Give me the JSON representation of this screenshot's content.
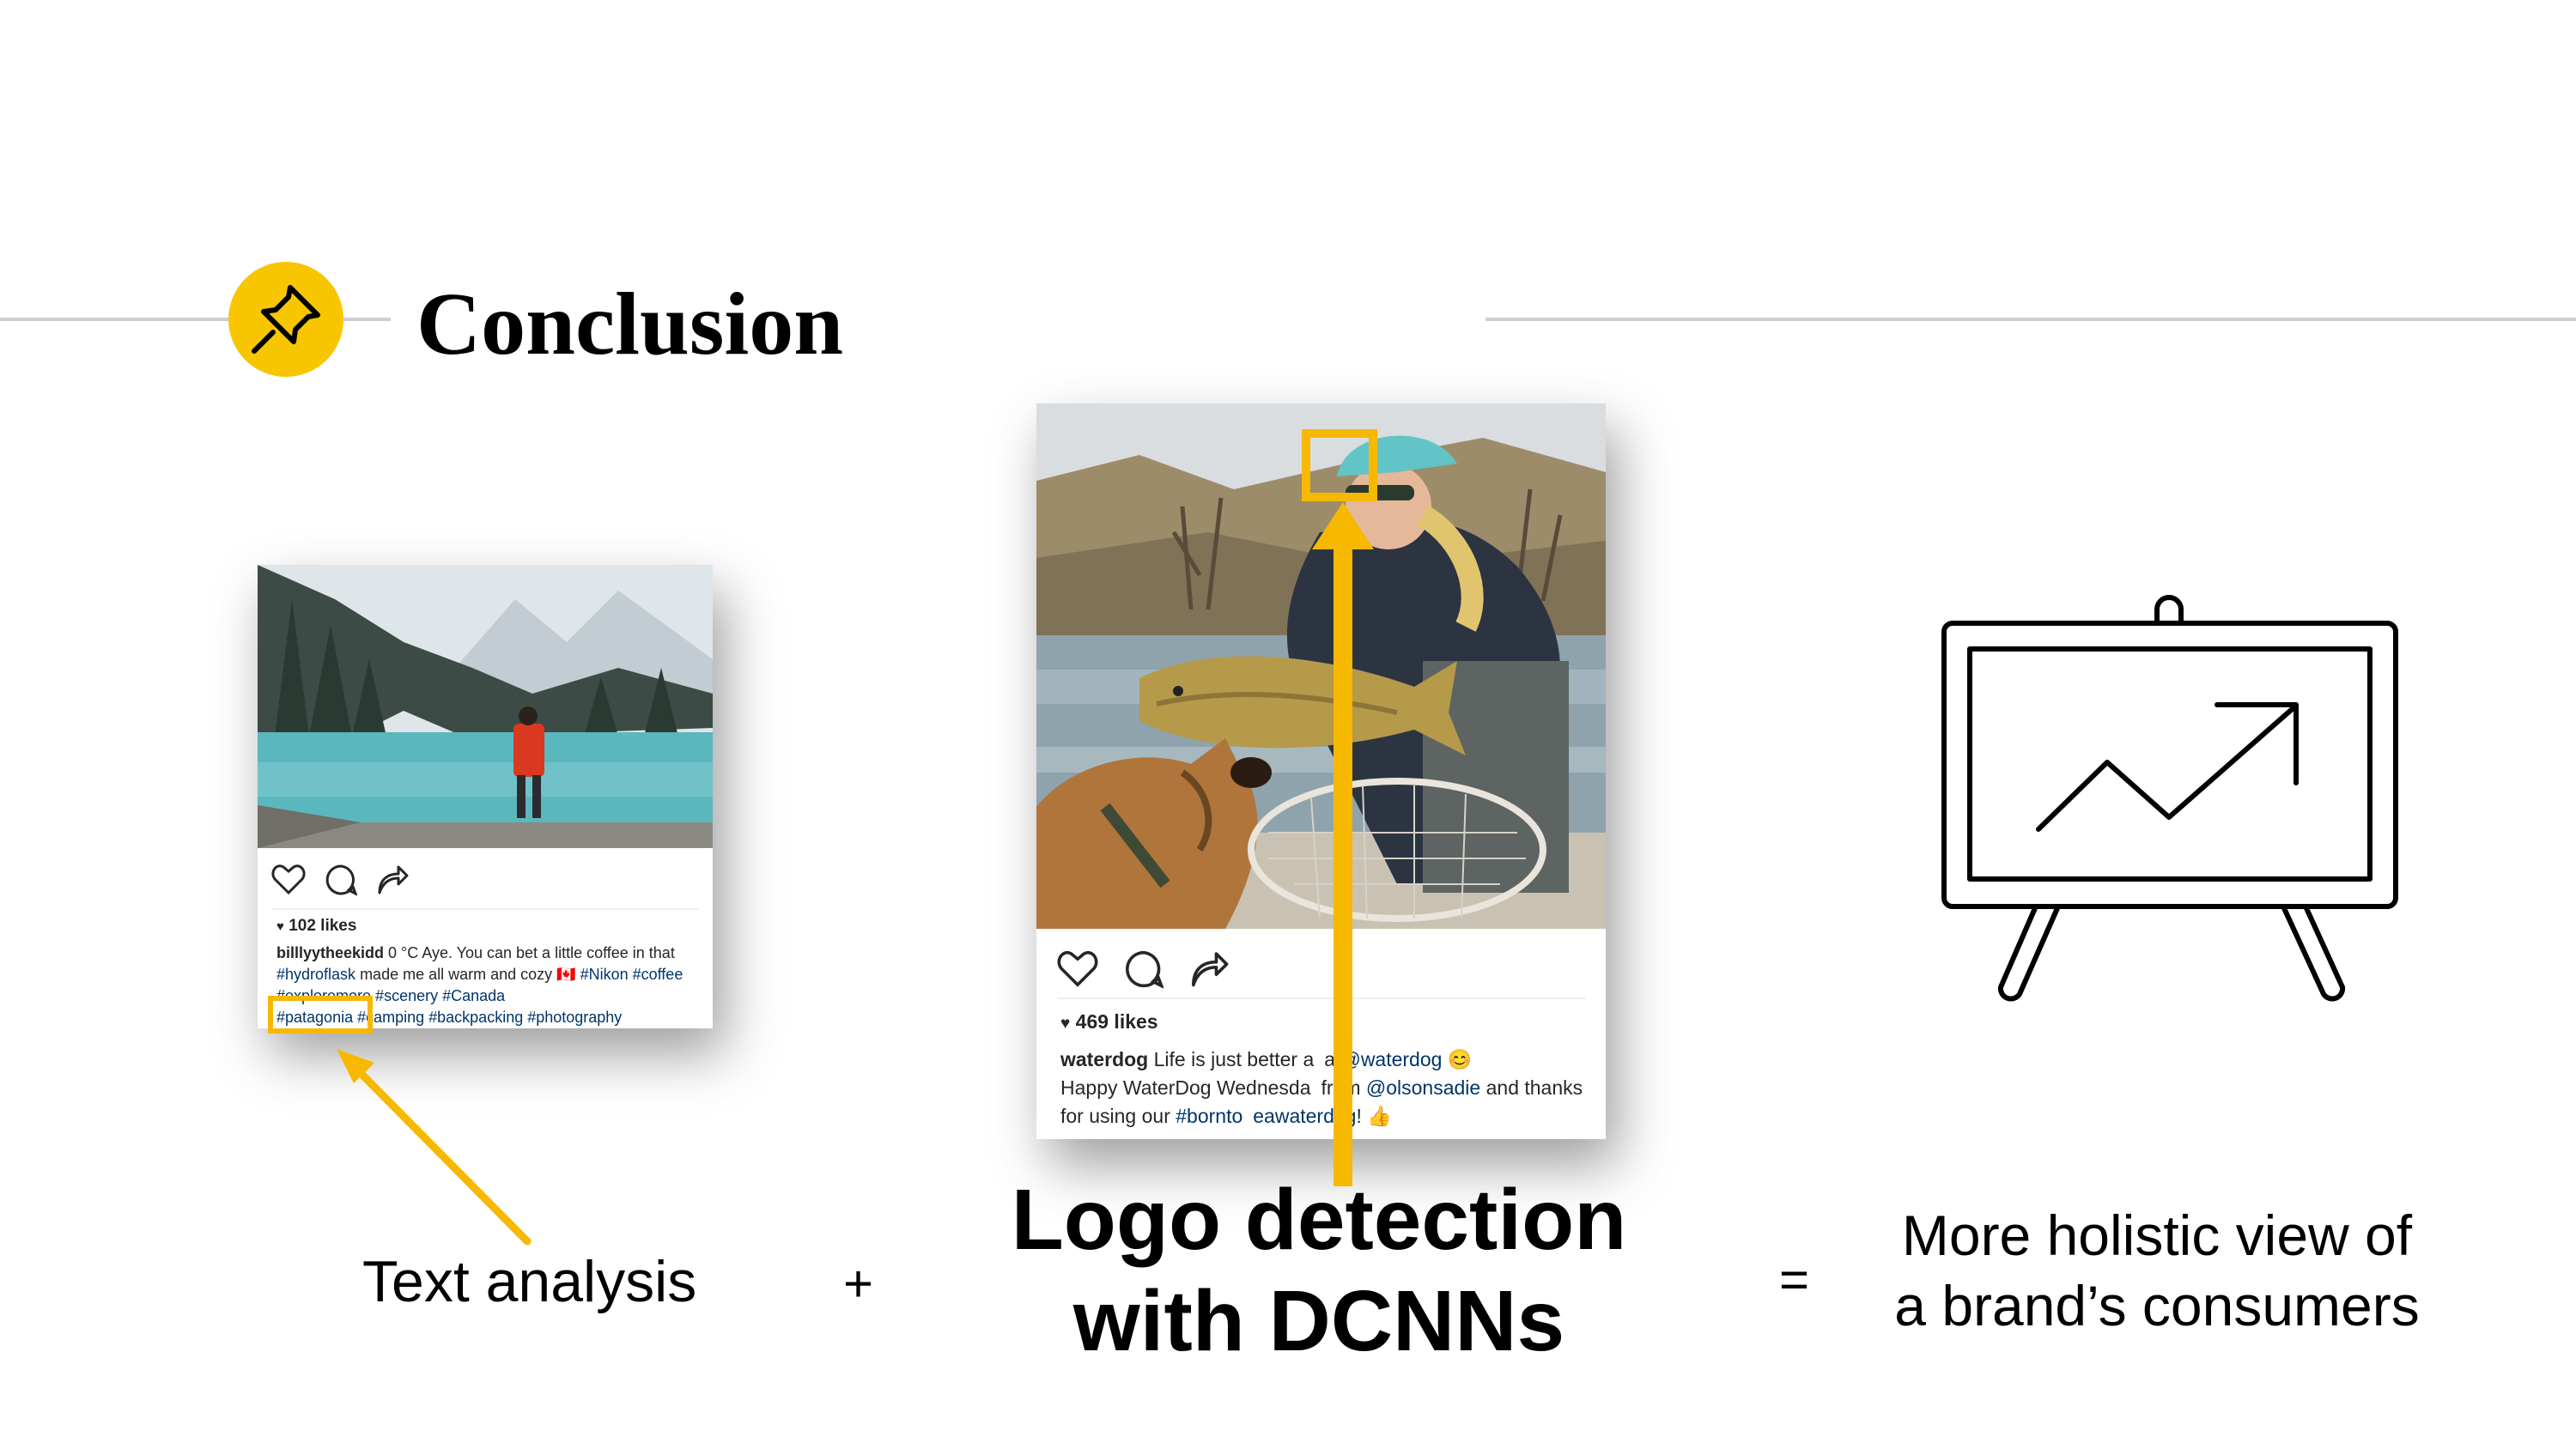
{
  "slide": {
    "title": "Conclusion",
    "header_icon": "pushpin-icon"
  },
  "post_left": {
    "icons": [
      "heart-icon",
      "comment-icon",
      "share-icon"
    ],
    "likes": "102 likes",
    "username": "billlyytheekidd",
    "caption_parts": [
      " 0 °C Aye. You can bet a little coffee in that ",
      "#hydroflask",
      " made me all warm and cozy 🇨🇦 ",
      "#Nikon #coffee #exploremore #scenery #Canada",
      "#patagonia",
      " #camping #backpacking #photography"
    ]
  },
  "post_right": {
    "icons": [
      "heart-icon",
      "comment-icon",
      "share-icon"
    ],
    "likes": "469 likes",
    "username": "waterdog",
    "caption_parts": [
      " Life is just better a",
      "a ",
      "@waterdog",
      " 😊",
      "Happy WaterDog Wednesda",
      "from ",
      "@olsonsadie",
      " and thanks for using our ",
      "#bornto",
      "eawaterdog",
      "! 👍"
    ]
  },
  "labels": {
    "text_analysis": "Text analysis",
    "plus": "+",
    "logo_line1": "Logo detection",
    "logo_line2": "with DCNNs",
    "equals": "=",
    "holistic_line1": "More holistic view of",
    "holistic_line2": "a brand’s consumers"
  },
  "easel_icon": "presentation-easel-chart-icon",
  "colors": {
    "accent_yellow": "#f7c600",
    "highlight_yellow": "#f7b800",
    "header_line": "#cfcfcf",
    "hashtag_blue": "#003569"
  }
}
